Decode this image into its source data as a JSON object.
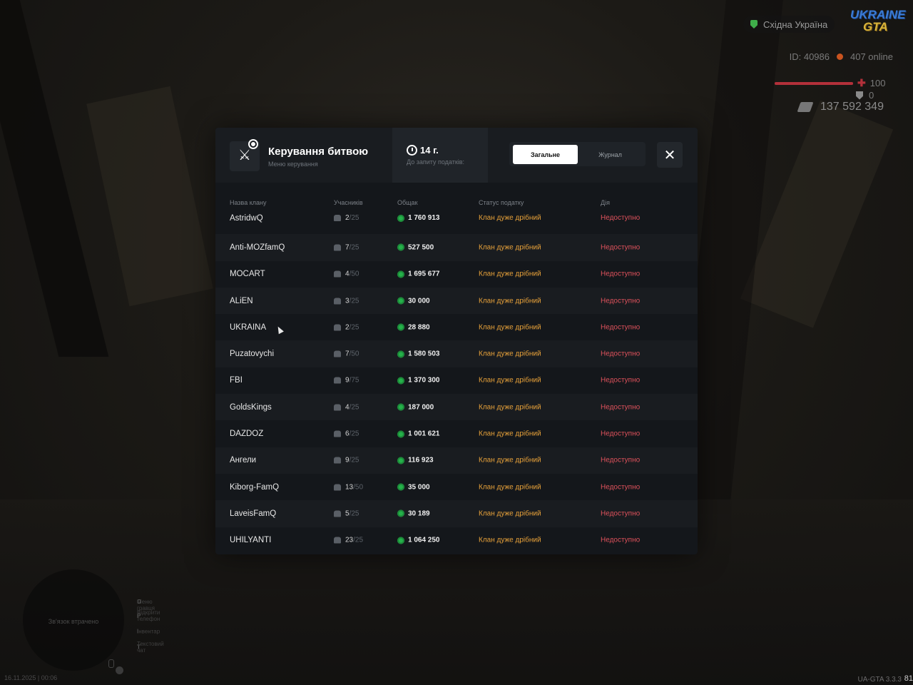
{
  "hud": {
    "region": "Східна Україна",
    "logo_top": "UKRAINE",
    "logo_bottom": "GTA",
    "player_id": "ID: 40986",
    "online": "407 online",
    "health": "100",
    "health_level": 1.0,
    "armor": "0",
    "money": "137 592 349",
    "datetime": "16.11.2025 | 00:06",
    "version": "UA-GTA 3.3.3",
    "version_extra": "81",
    "minimap_text": "Зв'язок втрачено",
    "hotkeys": [
      {
        "key": "O",
        "label": "Меню гравця"
      },
      {
        "key": "P",
        "label": "Відкрити телефон"
      },
      {
        "key": "I",
        "label": "Інвентар"
      },
      {
        "key": "T",
        "label": "Текстовий чат"
      }
    ]
  },
  "modal": {
    "title": "Керування битвою",
    "subtitle": "Меню керування",
    "timer_value": "14 г.",
    "timer_label": "До запиту податків:",
    "tabs": [
      "Загальне",
      "Журнал"
    ],
    "close": "✕",
    "columns": [
      "Назва клану",
      "Учасників",
      "Общак",
      "Статус податку",
      "Дія"
    ],
    "rows": [
      {
        "name": "AstridwQ",
        "members": "2",
        "max": "/25",
        "fund": "1 760 913",
        "status": "Клан дуже дрібний",
        "action": "Недоступно"
      },
      {
        "name": "Anti-MOZfamQ",
        "members": "7",
        "max": "/25",
        "fund": "527 500",
        "status": "Клан дуже дрібний",
        "action": "Недоступно"
      },
      {
        "name": "MOCART",
        "members": "4",
        "max": "/50",
        "fund": "1 695 677",
        "status": "Клан дуже дрібний",
        "action": "Недоступно"
      },
      {
        "name": "ALiEN",
        "members": "3",
        "max": "/25",
        "fund": "30 000",
        "status": "Клан дуже дрібний",
        "action": "Недоступно"
      },
      {
        "name": "UKRAINA",
        "members": "2",
        "max": "/25",
        "fund": "28 880",
        "status": "Клан дуже дрібний",
        "action": "Недоступно"
      },
      {
        "name": "Puzatovychi",
        "members": "7",
        "max": "/50",
        "fund": "1 580 503",
        "status": "Клан дуже дрібний",
        "action": "Недоступно"
      },
      {
        "name": "FBI",
        "members": "9",
        "max": "/75",
        "fund": "1 370 300",
        "status": "Клан дуже дрібний",
        "action": "Недоступно"
      },
      {
        "name": "GoldsKings",
        "members": "4",
        "max": "/25",
        "fund": "187 000",
        "status": "Клан дуже дрібний",
        "action": "Недоступно"
      },
      {
        "name": "DAZDOZ",
        "members": "6",
        "max": "/25",
        "fund": "1 001 621",
        "status": "Клан дуже дрібний",
        "action": "Недоступно"
      },
      {
        "name": "Ангели",
        "members": "9",
        "max": "/25",
        "fund": "116 923",
        "status": "Клан дуже дрібний",
        "action": "Недоступно"
      },
      {
        "name": "Kiborg-FamQ",
        "members": "13",
        "max": "/50",
        "fund": "35 000",
        "status": "Клан дуже дрібний",
        "action": "Недоступно"
      },
      {
        "name": "LaveisFamQ",
        "members": "5",
        "max": "/25",
        "fund": "30 189",
        "status": "Клан дуже дрібний",
        "action": "Недоступно"
      },
      {
        "name": "UHILYANTI",
        "members": "23",
        "max": "/25",
        "fund": "1 064 250",
        "status": "Клан дуже дрібний",
        "action": "Недоступно"
      }
    ]
  },
  "colors": {
    "status": "#e8a23a",
    "action": "#e0525c",
    "fund_icon": "#25b14a",
    "region_icon": "#3fae4a"
  },
  "icons": {
    "header": "crossed-swords-gear-icon",
    "timer": "clock-icon",
    "members": "people-icon",
    "fund": "coin-icon",
    "money": "cash-icon",
    "armor": "shield-icon",
    "health": "plus-icon"
  }
}
